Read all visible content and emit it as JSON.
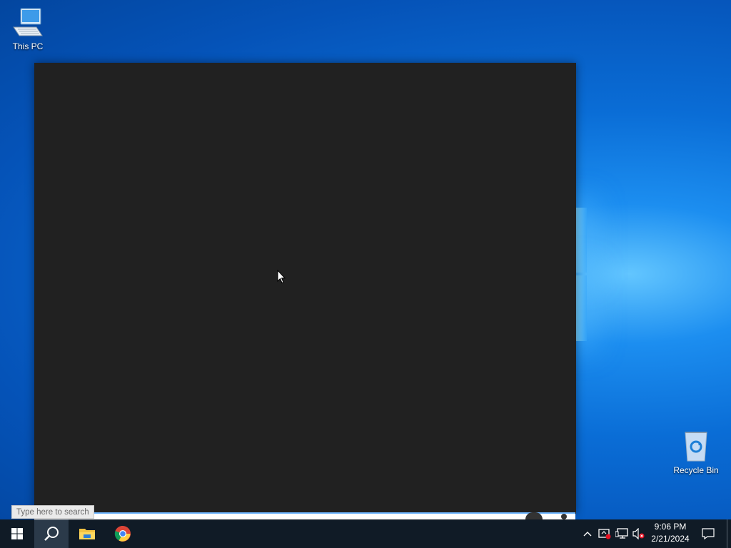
{
  "desktop": {
    "icons": [
      {
        "label": "This PC",
        "icon": "computer-icon"
      },
      {
        "label": "Recycle Bin",
        "icon": "recycle-bin-icon"
      }
    ]
  },
  "search": {
    "placeholder": "Type here to search"
  },
  "taskbar": {
    "pinned": [
      {
        "name": "Start",
        "icon": "windows-start-icon"
      },
      {
        "name": "Search",
        "icon": "search-icon"
      },
      {
        "name": "File Explorer",
        "icon": "folder-icon"
      },
      {
        "name": "Google Chrome",
        "icon": "chrome-icon"
      }
    ],
    "tray": {
      "icons": [
        "chevron-up-icon",
        "security-alert-icon",
        "network-icon",
        "volume-muted-icon"
      ],
      "time": "9:06 PM",
      "date": "2/21/2024",
      "notification_icon": "action-center-icon"
    }
  },
  "colors": {
    "taskbar_bg": "#101b26",
    "window_bg": "#212121",
    "desktop_blue": "#0a6dd6",
    "search_highlight": "#2b3a4a"
  }
}
